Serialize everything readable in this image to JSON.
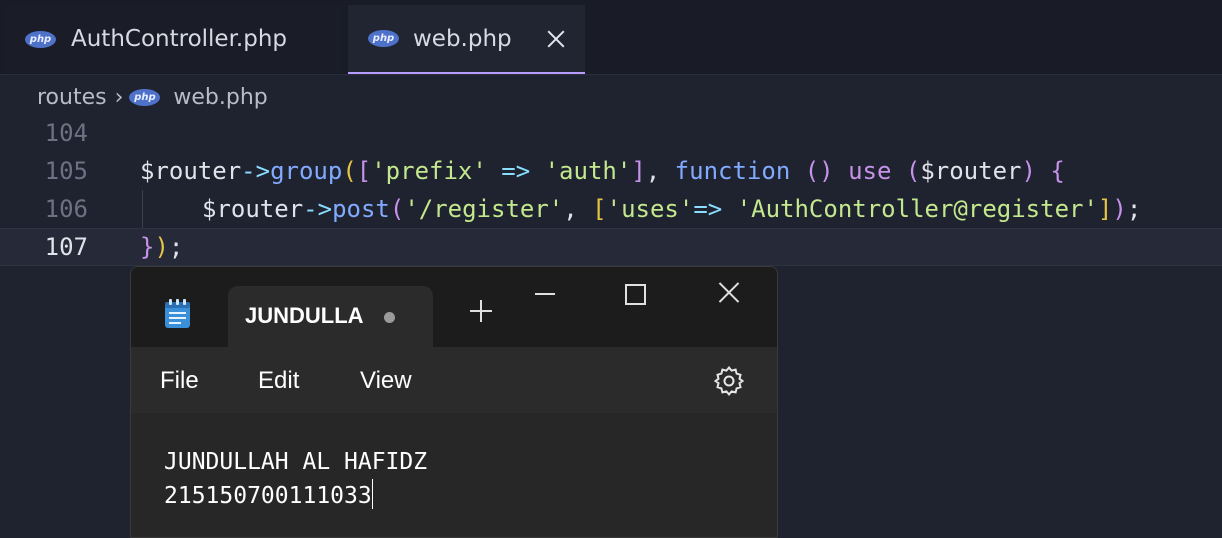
{
  "editor": {
    "tabs": [
      {
        "label": "AuthController.php",
        "icon": "php-file-icon",
        "active": false
      },
      {
        "label": "web.php",
        "icon": "php-file-icon",
        "active": true
      }
    ],
    "php_badge": "php",
    "breadcrumb": [
      "routes",
      "web.php"
    ],
    "lines": [
      {
        "number": "104"
      },
      {
        "number": "105"
      },
      {
        "number": "106"
      },
      {
        "number": "107",
        "current": true
      }
    ],
    "code": {
      "l105": {
        "var": "$router",
        "arrow": "->",
        "fn": "group",
        "open_paren": "(",
        "open_bracket": "[",
        "key": "'prefix'",
        "fat_arrow": " => ",
        "val": "'auth'",
        "close_bracket": "]",
        "comma": ", ",
        "kw_function": "function",
        "parens": " () ",
        "kw_use": "use",
        "use_open": " (",
        "use_var": "$router",
        "use_close": ") ",
        "brace": "{"
      },
      "l106": {
        "var": "$router",
        "arrow": "->",
        "fn": "post",
        "open_paren": "(",
        "path": "'/register'",
        "comma": ", ",
        "open_bracket": "[",
        "key": "'uses'",
        "fat_arrow": "=> ",
        "val": "'AuthController@register'",
        "close_bracket": "]",
        "close_paren": ")",
        "semi": ";"
      },
      "l107": {
        "brace": "}",
        "paren": ")",
        "semi": ";"
      }
    },
    "colors": {
      "background": "#1f2330",
      "accent": "#b79cff",
      "string": "#c3e88d",
      "function": "#82aaff",
      "keyword": "#c792ea"
    }
  },
  "notepad": {
    "app_icon": "notepad-icon",
    "tab_title": "JUNDULLAH AL HAFIDZ",
    "unsaved_indicator": "unsaved-dot",
    "menu": [
      "File",
      "Edit",
      "View"
    ],
    "settings_icon": "gear-icon",
    "content_lines": [
      "JUNDULLAH AL HAFIDZ",
      "215150700111033"
    ]
  }
}
